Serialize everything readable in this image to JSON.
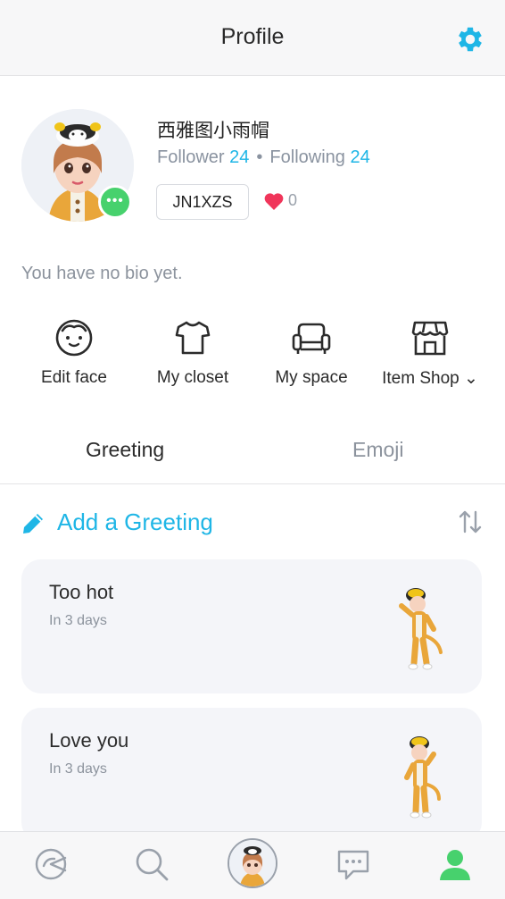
{
  "header": {
    "title": "Profile",
    "settings_icon": "gear-icon",
    "accent": "#1fb6e6"
  },
  "profile": {
    "username": "西雅图小雨帽",
    "follower_label": "Follower",
    "follower_count": "24",
    "separator": "•",
    "following_label": "Following",
    "following_count": "24",
    "code": "JN1XZS",
    "likes": "0",
    "status_dots": "•••",
    "bio": "You have no bio yet."
  },
  "quick_actions": [
    {
      "label": "Edit face",
      "icon": "face-icon"
    },
    {
      "label": "My closet",
      "icon": "shirt-icon"
    },
    {
      "label": "My space",
      "icon": "sofa-icon"
    },
    {
      "label": "Item Shop ⌄",
      "icon": "store-icon"
    }
  ],
  "tabs": {
    "greeting": "Greeting",
    "emoji": "Emoji"
  },
  "greetings": {
    "add_label": "Add a Greeting",
    "items": [
      {
        "title": "Too hot",
        "subtitle": "In 3 days"
      },
      {
        "title": "Love you",
        "subtitle": "In 3 days"
      }
    ]
  },
  "bottom_nav": [
    "home-icon",
    "search-icon",
    "avatar-camera",
    "chat-icon",
    "profile-icon"
  ],
  "colors": {
    "accent": "#1fb6e6",
    "online": "#47d16d",
    "heart": "#f0355a",
    "active_tab": "#47d16d"
  }
}
